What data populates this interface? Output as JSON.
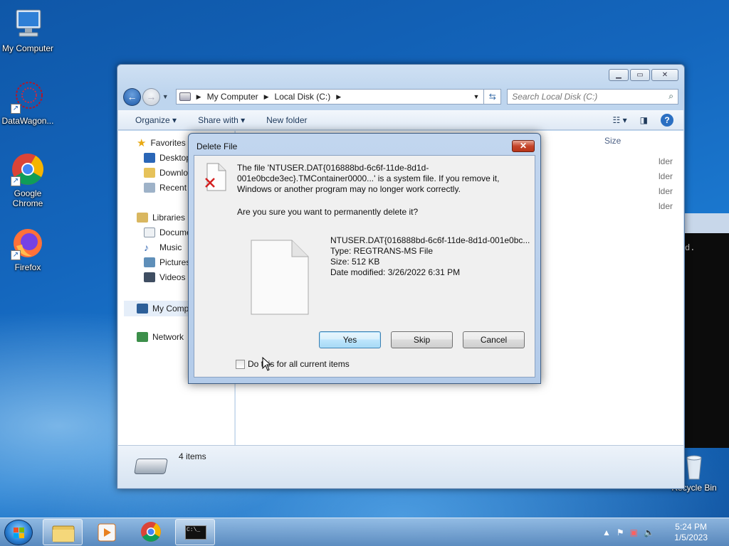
{
  "desktop": {
    "icons": [
      {
        "label": "My Computer"
      },
      {
        "label": "DataWagon..."
      },
      {
        "label": "Google Chrome"
      },
      {
        "label": "Firefox"
      },
      {
        "label": "Recycle Bin"
      }
    ]
  },
  "explorer": {
    "breadcrumb": [
      "My Computer",
      "Local Disk (C:)"
    ],
    "search_placeholder": "Search Local Disk (C:)",
    "toolbar": {
      "organize": "Organize",
      "share_with": "Share with",
      "new_folder": "New folder"
    },
    "column_size": "Size",
    "folder_type_label": "lder",
    "nav": {
      "favorites": "Favorites",
      "desktop": "Desktop",
      "downloads": "Downlo",
      "recent": "Recent P",
      "libraries": "Libraries",
      "documents": "Docume",
      "music": "Music",
      "pictures": "Pictures",
      "videos": "Videos",
      "my_computer": "My Comp",
      "network": "Network"
    },
    "status_items": "4 items"
  },
  "console": {
    "text": "d."
  },
  "dialog": {
    "title": "Delete File",
    "message": "The file 'NTUSER.DAT{016888bd-6c6f-11de-8d1d-001e0bcde3ec}.TMContainer0000...' is a system file. If you remove it, Windows or another program may no longer work correctly.",
    "confirm": "Are you sure you want to permanently delete it?",
    "file": {
      "name": "NTUSER.DAT{016888bd-6c6f-11de-8d1d-001e0bc...",
      "type": "Type: REGTRANS-MS File",
      "size": "Size: 512 KB",
      "modified": "Date modified: 3/26/2022 6:31 PM"
    },
    "buttons": {
      "yes": "Yes",
      "skip": "Skip",
      "cancel": "Cancel"
    },
    "checkbox_label": "Do this for all current items"
  },
  "taskbar": {
    "time": "5:24 PM",
    "date": "1/5/2023",
    "console_icon_text": "C:\\_"
  }
}
